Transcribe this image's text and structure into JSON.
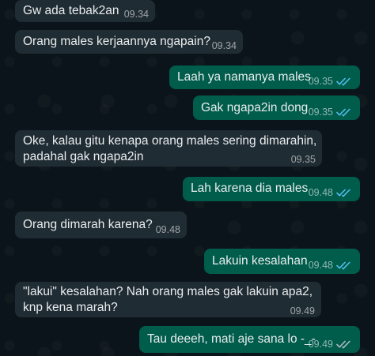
{
  "colors": {
    "background": "#0b141a",
    "incoming_bubble": "#202c33",
    "outgoing_bubble": "#005c4b",
    "text": "#e9edef",
    "read_ticks": "#53bdeb",
    "delivered_ticks": "#aebac1"
  },
  "messages": [
    {
      "direction": "in",
      "text": "Gw ada tebak2an",
      "time": "09.34",
      "status": ""
    },
    {
      "direction": "in",
      "text": "Orang males kerjaannya ngapain?",
      "time": "09.34",
      "status": ""
    },
    {
      "direction": "out",
      "text": "Laah ya namanya males",
      "time": "09.35",
      "status": "read"
    },
    {
      "direction": "out",
      "text": "Gak ngapa2in dong",
      "time": "09.35",
      "status": "read"
    },
    {
      "direction": "in",
      "text": "Oke, kalau gitu kenapa orang males sering dimarahin,\npadahal gak ngapa2in",
      "time": "09.35",
      "status": ""
    },
    {
      "direction": "out",
      "text": "Lah karena dia males",
      "time": "09.48",
      "status": "read"
    },
    {
      "direction": "in",
      "text": "Orang dimarah karena?",
      "time": "09.48",
      "status": ""
    },
    {
      "direction": "out",
      "text": "Lakuin kesalahan",
      "time": "09.48",
      "status": "read"
    },
    {
      "direction": "in",
      "text": "\"lakui\" kesalahan? Nah orang males gak lakuin apa2,\nknp kena marah?",
      "time": "09.49",
      "status": ""
    },
    {
      "direction": "out",
      "text": "Tau deeeh, mati aje sana lo -_-",
      "time": "09.49",
      "status": "delivered"
    }
  ]
}
